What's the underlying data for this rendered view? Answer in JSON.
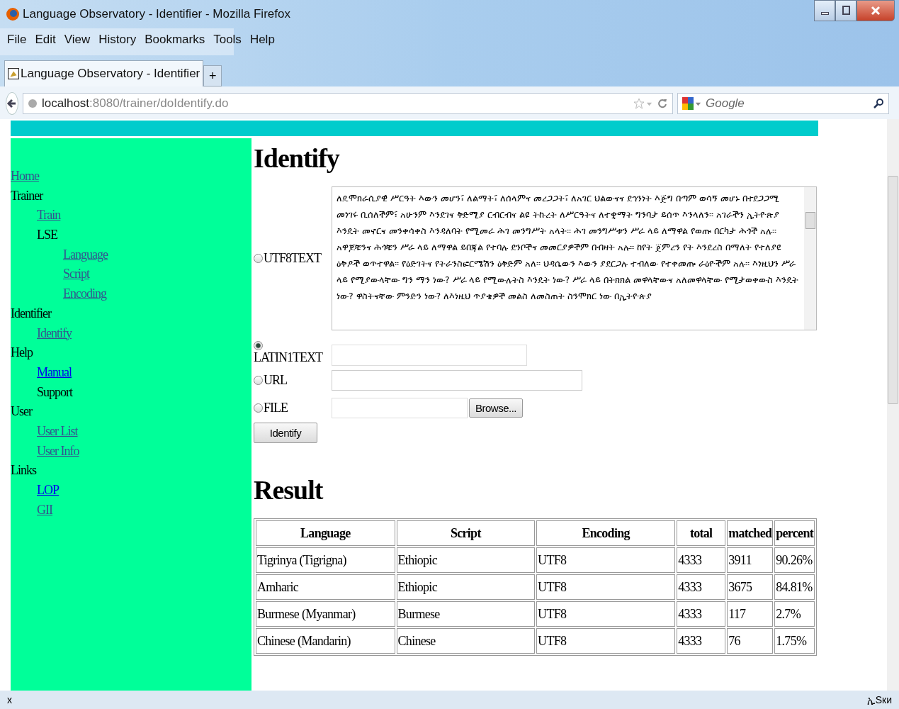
{
  "window": {
    "title": "Language Observatory - Identifier - Mozilla Firefox"
  },
  "menu": [
    "File",
    "Edit",
    "View",
    "History",
    "Bookmarks",
    "Tools",
    "Help"
  ],
  "tabs": [
    {
      "label": "Language Observatory - Identifier",
      "selected": true
    }
  ],
  "new_tab": "+",
  "address": {
    "host": "localhost",
    "path": ":8080/trainer/doIdentify.do"
  },
  "search": {
    "placeholder": "Google"
  },
  "sidebar": {
    "items": [
      {
        "label": "Home",
        "link": true,
        "visited": true
      },
      {
        "label": "Trainer",
        "link": false,
        "children": [
          {
            "label": "Train",
            "link": true,
            "visited": true
          },
          {
            "label": "LSE",
            "link": false,
            "children": [
              {
                "label": "Language",
                "link": true,
                "visited": true
              },
              {
                "label": "Script",
                "link": true,
                "visited": true
              },
              {
                "label": "Encoding",
                "link": true,
                "visited": true
              }
            ]
          }
        ]
      },
      {
        "label": "Identifier",
        "link": false,
        "children": [
          {
            "label": "Identify",
            "link": true,
            "visited": true
          }
        ]
      },
      {
        "label": "Help",
        "link": false,
        "children": [
          {
            "label": "Manual",
            "link": true,
            "visited": false
          },
          {
            "label": "Support",
            "link": false
          }
        ]
      },
      {
        "label": "User",
        "link": false,
        "children": [
          {
            "label": "User List",
            "link": true,
            "visited": true
          },
          {
            "label": "User Info",
            "link": true,
            "visited": true
          }
        ]
      },
      {
        "label": "Links",
        "link": false,
        "children": [
          {
            "label": "LOP",
            "link": true,
            "visited": false
          },
          {
            "label": "GII",
            "link": true,
            "visited": true
          }
        ]
      }
    ]
  },
  "heading": "Identify",
  "form": {
    "rows": [
      {
        "kind": "textarea",
        "label": "UTF8TEXT",
        "selected": false,
        "value": "ለዴሞክራሲያዊ ሥርዓት እውን መሆን፣ ለልማት፣ ለሰላምና መረጋጋት፣ ለአገር ህልውናና ደኅንነት እጅግ በጣም ወሳኝ መሆኑ በተደጋጋሚ መነገሩ ቢሰለችም፣ አሁንም እንደገና ቅድሚያ ርብርብና ልዩ ትኩረት ለሥርዓትና ለተቋማት ግንባታ ይሰጥ እንላለን። አገራችን ኢትዮጵያ እንዴት መኖርና መንቀሳቀስ እንዳለባት የሚመራ ሕገ መንግሥት አላት። ሕገ መንግሥቱን ሥራ ላይ ለማዋል የወጡ በርካታ ሕጎች አሉ። አዋጆቹንና ሕጎቹን ሥራ ላይ ለማዋል ይበጃል የተባሉ ደንቦችና መመርያዎችም በብዛት አሉ። ከየት ጀምረን የት እንደረስ በማለት የተለያዩ ዕቅዶች ወጥተዋል። የዕድገትና የትራንስፎርሜሽን ዕቅድም አለ። ህዳሴውን እውን ያደርጋሉ ተብለው የተቀመጡ ራዕዮችም አሉ። እነዚህን ሥራ ላይ የሚያውላቸው ግን ማን ነው? ሥራ ላይ የሚውሉትስ እንዴት ነው? ሥራ ላይ በትክክል መዋላቸውና አለመዋላቸው የሚታወቀውስ እንዴት ነው? ዋስትናቸው ምንድን ነው? ለእነዚህ ጥያቄዎች መልስ ለመስጠት ስንሞክር ነው በኢትዮጵያ"
      },
      {
        "kind": "small-textarea",
        "label": "LATIN1TEXT",
        "selected": true
      },
      {
        "kind": "text",
        "label": "URL",
        "selected": false
      },
      {
        "kind": "file",
        "label": "FILE",
        "selected": false,
        "button": "Browse..."
      }
    ],
    "submit": "Identify"
  },
  "result_heading": "Result",
  "table": {
    "columns": [
      "Language",
      "Script",
      "Encoding",
      "total",
      "matched",
      "percent"
    ],
    "rows": [
      [
        "Tigrinya (Tigrigna)",
        "Ethiopic",
        "UTF8",
        "4333",
        "3911",
        "90.26%"
      ],
      [
        "Amharic",
        "Ethiopic",
        "UTF8",
        "4333",
        "3675",
        "84.81%"
      ],
      [
        "Burmese (Myanmar)",
        "Burmese",
        "UTF8",
        "4333",
        "117",
        "2.7%"
      ],
      [
        "Chinese (Mandarin)",
        "Chinese",
        "UTF8",
        "4333",
        "76",
        "1.75%"
      ]
    ]
  },
  "status_bar": {
    "close": "x",
    "indicator": "ኢSки"
  }
}
